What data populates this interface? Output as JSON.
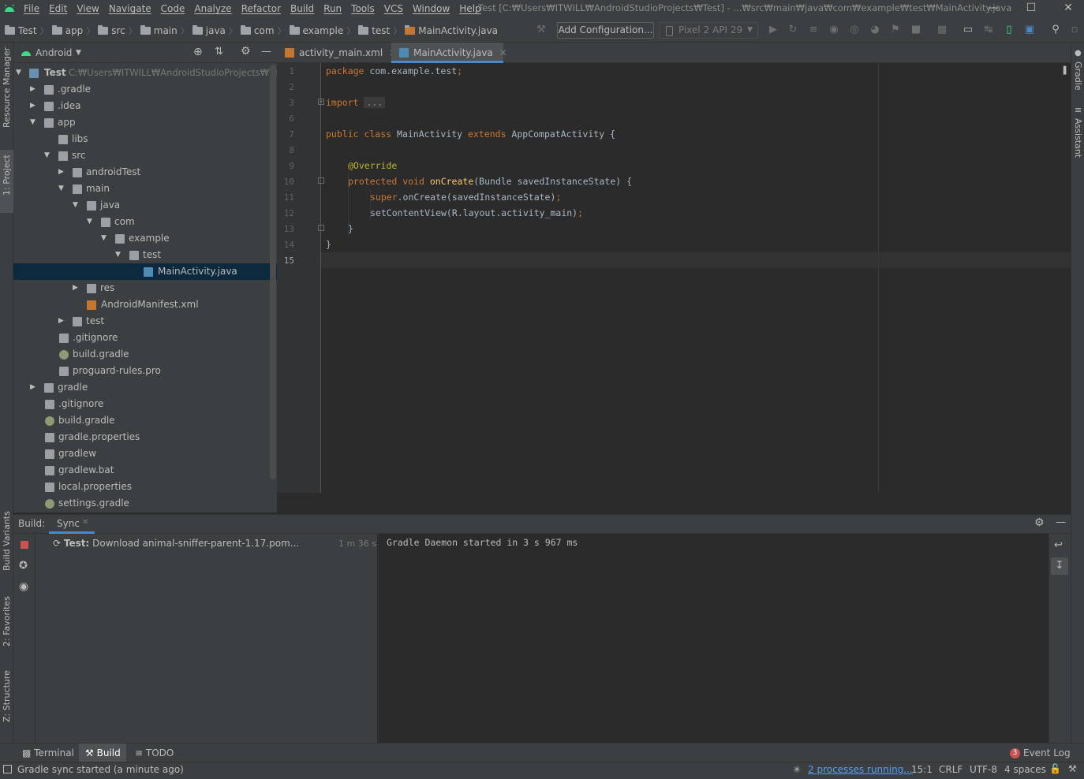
{
  "menu": [
    "File",
    "Edit",
    "View",
    "Navigate",
    "Code",
    "Analyze",
    "Refactor",
    "Build",
    "Run",
    "Tools",
    "VCS",
    "Window",
    "Help"
  ],
  "window_title": "Test [C:₩Users₩ITWILL₩AndroidStudioProjects₩Test] - ...₩src₩main₩java₩com₩example₩test₩MainActivity.java",
  "breadcrumbs": [
    "Test",
    "app",
    "src",
    "main",
    "java",
    "com",
    "example",
    "test",
    "MainActivity.java"
  ],
  "toolbar": {
    "add_config": "Add Configuration...",
    "device": "Pixel 2 API 29"
  },
  "project": {
    "view_selector": "Android",
    "root_label": "Test",
    "root_path": "C:₩Users₩ITWILL₩AndroidStudioProjects₩Test",
    "items": [
      ".gradle",
      ".idea",
      "app",
      "libs",
      "src",
      "androidTest",
      "main",
      "java",
      "com",
      "example",
      "test",
      "MainActivity.java",
      "res",
      "AndroidManifest.xml",
      "test",
      ".gitignore",
      "build.gradle",
      "proguard-rules.pro",
      "gradle",
      ".gitignore",
      "build.gradle",
      "gradle.properties",
      "gradlew",
      "gradlew.bat",
      "local.properties",
      "settings.gradle"
    ]
  },
  "tabs": [
    "activity_main.xml",
    "MainActivity.java"
  ],
  "editor": {
    "line_numbers": [
      "1",
      "2",
      "3",
      "6",
      "7",
      "8",
      "9",
      "10",
      "11",
      "12",
      "13",
      "14",
      "15"
    ],
    "lines": [
      {
        "kw": "package ",
        "rest": "com.example.test",
        "sc": ";"
      },
      {
        "kw": "",
        "rest": "",
        "sc": ""
      },
      {
        "kw": "import ",
        "rest": "...",
        "sc": ""
      },
      {
        "kw": "",
        "rest": "",
        "sc": ""
      },
      {
        "kw": "public class ",
        "rest": "MainActivity ",
        "kw2": "extends ",
        "rest2": "AppCompatActivity {"
      },
      {
        "kw": "",
        "rest": "",
        "sc": ""
      },
      {
        "ann": "@Override"
      },
      {
        "kw": "protected void ",
        "fn": "onCreate",
        "rest": "(Bundle savedInstanceState) {"
      },
      {
        "kw": "super",
        "rest": ".onCreate(savedInstanceState)",
        "sc": ";"
      },
      {
        "kw": "",
        "rest": "setContentView(R.layout.activity_main)",
        "sc": ";"
      },
      {
        "kw": "",
        "rest": "}",
        "sc": ""
      },
      {
        "kw": "",
        "rest": "}",
        "sc": ""
      },
      {
        "kw": "",
        "rest": "",
        "sc": ""
      }
    ]
  },
  "side_labels": {
    "resource_manager": "Resource Manager",
    "project": "1: Project",
    "build_variants": "Build Variants",
    "favorites": "2: Favorites",
    "structure": "Z: Structure",
    "gradle": "Gradle",
    "assistant": "Assistant"
  },
  "build": {
    "label": "Build:",
    "tab": "Sync",
    "task_prefix": "Test:",
    "task": "Download animal-sniffer-parent-1.17.pom...",
    "duration": "1 m 36 s",
    "log": "Gradle Daemon started in 3 s 967 ms"
  },
  "bottom_tabs": [
    "Terminal",
    "Build",
    "TODO"
  ],
  "event_log": "Event Log",
  "event_count": "3",
  "status": {
    "message": "Gradle sync started (a minute ago)",
    "processes": "2 processes running...",
    "position": "15:1",
    "line_sep": "CRLF",
    "encoding": "UTF-8",
    "indent": "4 spaces"
  }
}
